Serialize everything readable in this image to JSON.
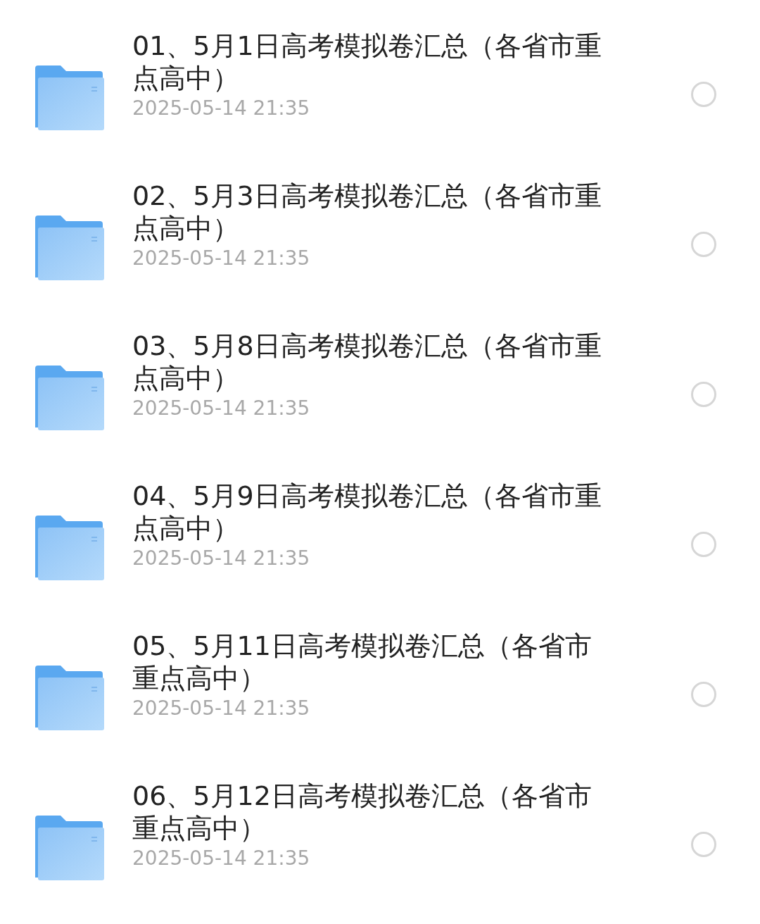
{
  "files": [
    {
      "name": "01、5月1日高考模拟卷汇总（各省市重点高中）",
      "time": "2025-05-14 21:35",
      "selected": false
    },
    {
      "name": "02、5月3日高考模拟卷汇总（各省市重点高中）",
      "time": "2025-05-14 21:35",
      "selected": false
    },
    {
      "name": "03、5月8日高考模拟卷汇总（各省市重点高中）",
      "time": "2025-05-14 21:35",
      "selected": false
    },
    {
      "name": "04、5月9日高考模拟卷汇总（各省市重点高中）",
      "time": "2025-05-14 21:35",
      "selected": false
    },
    {
      "name": "05、5月11日高考模拟卷汇总（各省市重点高中）",
      "time": "2025-05-14 21:35",
      "selected": false
    },
    {
      "name": "06、5月12日高考模拟卷汇总（各省市重点高中）",
      "time": "2025-05-14 21:35",
      "selected": false
    }
  ]
}
